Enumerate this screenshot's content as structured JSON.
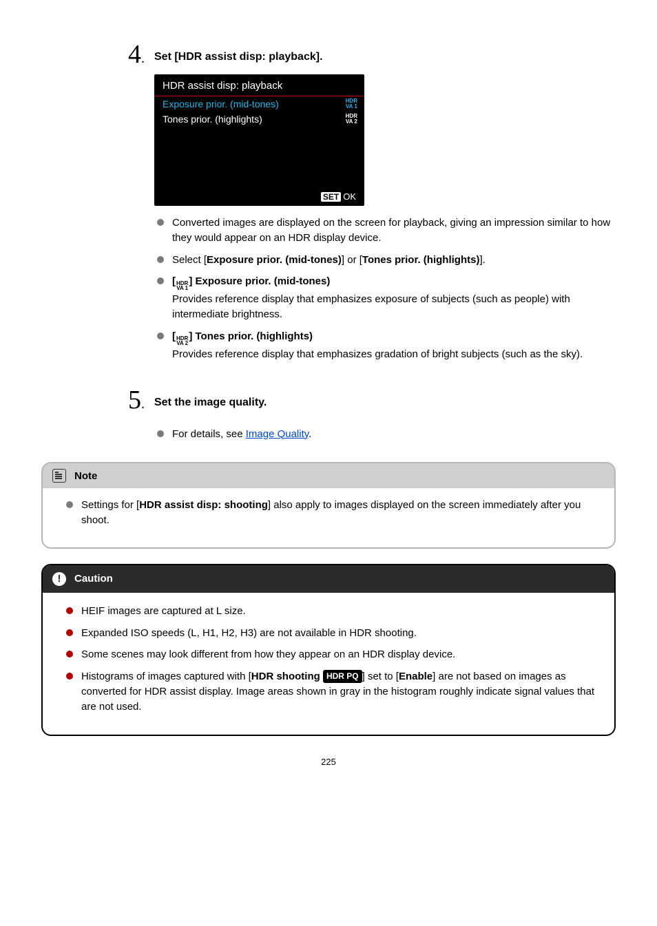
{
  "step4": {
    "num": "4",
    "title": "Set [HDR assist disp: playback].",
    "menu": {
      "title": "HDR assist disp: playback",
      "row1_label": "Exposure prior. (mid-tones)",
      "row1_tag_top": "HDR",
      "row1_tag_bot": "VA 1",
      "row2_label": "Tones prior. (highlights)",
      "row2_tag_top": "HDR",
      "row2_tag_bot": "VA 2",
      "ok_set": "SET",
      "ok_ok": "OK"
    },
    "bullets": {
      "b1": "Converted images are displayed on the screen for playback, giving an impression similar to how they would appear on an HDR display device.",
      "b2_pre": "Select [",
      "b2_bold1": "Exposure prior. (mid-tones)",
      "b2_mid": "] or [",
      "b2_bold2": "Tones prior. (highlights)",
      "b2_post": "].",
      "b3_icon_top": "HDR",
      "b3_icon_bot": "VA 1",
      "b3_title": "] Exposure prior. (mid-tones)",
      "b3_desc": "Provides reference display that emphasizes exposure of subjects (such as people) with intermediate brightness.",
      "b4_icon_top": "HDR",
      "b4_icon_bot": "VA 2",
      "b4_title": "] Tones prior. (highlights)",
      "b4_desc": "Provides reference display that emphasizes gradation of bright subjects (such as the sky)."
    }
  },
  "step5": {
    "num": "5",
    "title": "Set the image quality.",
    "bullet_pre": "For details, see ",
    "bullet_link": "Image Quality",
    "bullet_post": "."
  },
  "note": {
    "heading": "Note",
    "item_pre": "Settings for [",
    "item_bold": "HDR assist disp: shooting",
    "item_post": "] also apply to images displayed on the screen immediately after you shoot."
  },
  "caution": {
    "heading": "Caution",
    "c1": "HEIF images are captured at L size.",
    "c2": "Expanded ISO speeds (L, H1, H2, H3) are not available in HDR shooting.",
    "c3": "Some scenes may look different from how they appear on an HDR display device.",
    "c4_pre": "Histograms of images captured with [",
    "c4_bold1": "HDR shooting ",
    "c4_hdrpq": "HDR PQ",
    "c4_mid": "] set to [",
    "c4_bold2": "Enable",
    "c4_post": "] are not based on images as converted for HDR assist display. Image areas shown in gray in the histogram roughly indicate signal values that are not used."
  },
  "page_number": "225"
}
